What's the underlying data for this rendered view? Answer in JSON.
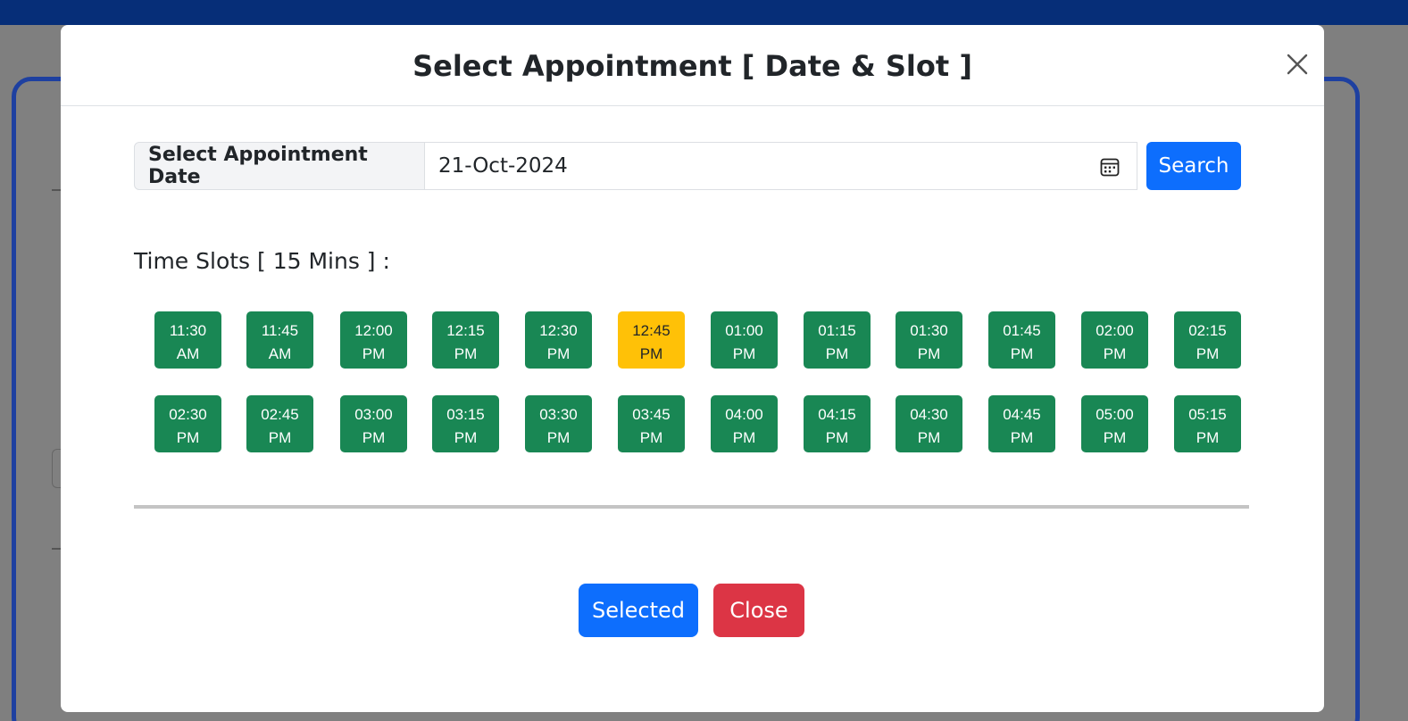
{
  "modal": {
    "title": "Select Appointment [ Date & Slot ]",
    "date_label": "Select Appointment Date",
    "date_value": "21-Oct-2024",
    "search_label": "Search",
    "slots_heading": "Time Slots [ 15 Mins ] :",
    "selected_label": "Selected",
    "close_label": "Close"
  },
  "slots": [
    {
      "time": "11:30",
      "period": "AM",
      "selected": false
    },
    {
      "time": "11:45",
      "period": "AM",
      "selected": false
    },
    {
      "time": "12:00",
      "period": "PM",
      "selected": false
    },
    {
      "time": "12:15",
      "period": "PM",
      "selected": false
    },
    {
      "time": "12:30",
      "period": "PM",
      "selected": false
    },
    {
      "time": "12:45",
      "period": "PM",
      "selected": true
    },
    {
      "time": "01:00",
      "period": "PM",
      "selected": false
    },
    {
      "time": "01:15",
      "period": "PM",
      "selected": false
    },
    {
      "time": "01:30",
      "period": "PM",
      "selected": false
    },
    {
      "time": "01:45",
      "period": "PM",
      "selected": false
    },
    {
      "time": "02:00",
      "period": "PM",
      "selected": false
    },
    {
      "time": "02:15",
      "period": "PM",
      "selected": false
    },
    {
      "time": "02:30",
      "period": "PM",
      "selected": false
    },
    {
      "time": "02:45",
      "period": "PM",
      "selected": false
    },
    {
      "time": "03:00",
      "period": "PM",
      "selected": false
    },
    {
      "time": "03:15",
      "period": "PM",
      "selected": false
    },
    {
      "time": "03:30",
      "period": "PM",
      "selected": false
    },
    {
      "time": "03:45",
      "period": "PM",
      "selected": false
    },
    {
      "time": "04:00",
      "period": "PM",
      "selected": false
    },
    {
      "time": "04:15",
      "period": "PM",
      "selected": false
    },
    {
      "time": "04:30",
      "period": "PM",
      "selected": false
    },
    {
      "time": "04:45",
      "period": "PM",
      "selected": false
    },
    {
      "time": "05:00",
      "period": "PM",
      "selected": false
    },
    {
      "time": "05:15",
      "period": "PM",
      "selected": false
    }
  ],
  "colors": {
    "slot_available": "#198754",
    "slot_selected": "#ffc107",
    "primary": "#0d6efd",
    "danger": "#dc3545",
    "topbar": "#062e78"
  },
  "icons": {
    "close": "close-icon",
    "calendar": "calendar-icon"
  }
}
